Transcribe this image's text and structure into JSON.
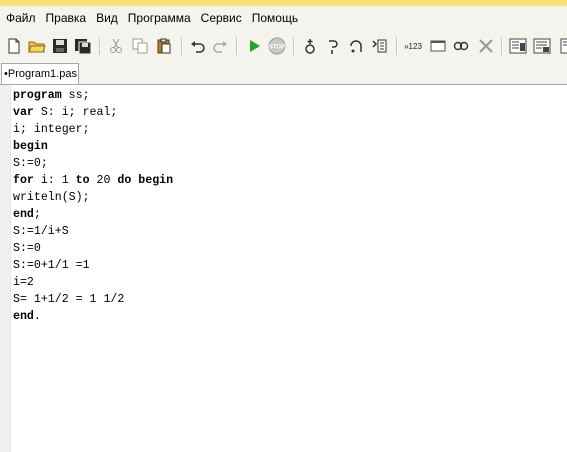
{
  "menu": {
    "items": [
      "Файл",
      "Правка",
      "Вид",
      "Программа",
      "Сервис",
      "Помощь"
    ]
  },
  "toolbar": {
    "buttons": [
      "new-file",
      "open-folder",
      "save",
      "save-all",
      "cut",
      "copy",
      "paste",
      "undo",
      "redo",
      "run",
      "stop",
      "add-watch",
      "step-into",
      "step-over",
      "watch-list",
      "goto-line",
      "toggle-output",
      "zoom",
      "close",
      "format-1",
      "format-2",
      "format-3"
    ],
    "goto_label": "»123",
    "stop_label": "STOP"
  },
  "tabs": [
    {
      "label": "•Program1.pas"
    }
  ],
  "editor": {
    "lines": [
      {
        "segments": [
          {
            "t": "program",
            "kw": true
          },
          {
            "t": " ss;",
            "kw": false
          }
        ]
      },
      {
        "segments": [
          {
            "t": "var",
            "kw": true
          },
          {
            "t": " S: i; real;",
            "kw": false
          }
        ]
      },
      {
        "segments": [
          {
            "t": "i; integer;",
            "kw": false
          }
        ]
      },
      {
        "segments": [
          {
            "t": "begin",
            "kw": true
          }
        ]
      },
      {
        "segments": [
          {
            "t": "S:=0;",
            "kw": false
          }
        ]
      },
      {
        "segments": [
          {
            "t": "for",
            "kw": true
          },
          {
            "t": " i: 1 ",
            "kw": false
          },
          {
            "t": "to",
            "kw": true
          },
          {
            "t": " 20 ",
            "kw": false
          },
          {
            "t": "do",
            "kw": true
          },
          {
            "t": " ",
            "kw": false
          },
          {
            "t": "begin",
            "kw": true
          }
        ]
      },
      {
        "segments": [
          {
            "t": "writeln(S);",
            "kw": false
          }
        ]
      },
      {
        "segments": [
          {
            "t": "end",
            "kw": true
          },
          {
            "t": ";",
            "kw": false
          }
        ]
      },
      {
        "segments": [
          {
            "t": "S:=1/i+S",
            "kw": false
          }
        ]
      },
      {
        "segments": [
          {
            "t": "S:=0",
            "kw": false
          }
        ]
      },
      {
        "segments": [
          {
            "t": "S:=0+1/1 =1",
            "kw": false
          }
        ]
      },
      {
        "segments": [
          {
            "t": "i=2",
            "kw": false
          }
        ]
      },
      {
        "segments": [
          {
            "t": "S= 1+1/2 = 1 1/2",
            "kw": false
          }
        ]
      },
      {
        "segments": [
          {
            "t": "end",
            "kw": true
          },
          {
            "t": ".",
            "kw": false
          }
        ]
      }
    ]
  },
  "colors": {
    "title_accent": "#f5e27a",
    "chrome_bg": "#f4f3ee",
    "run_green": "#2ca02c"
  }
}
